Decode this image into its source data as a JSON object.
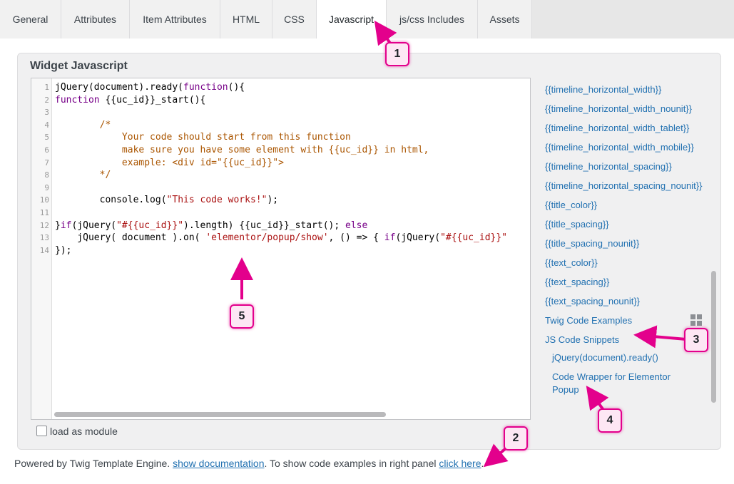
{
  "tabs": [
    {
      "label": "General"
    },
    {
      "label": "Attributes"
    },
    {
      "label": "Item Attributes"
    },
    {
      "label": "HTML"
    },
    {
      "label": "CSS"
    },
    {
      "label": "Javascript",
      "active": true
    },
    {
      "label": "js/css Includes"
    },
    {
      "label": "Assets"
    }
  ],
  "panel": {
    "title": "Widget Javascript"
  },
  "editor": {
    "line_numbers": [
      "1",
      "2",
      "3",
      "4",
      "5",
      "6",
      "7",
      "8",
      "9",
      "10",
      "11",
      "12",
      "13",
      "14"
    ],
    "lines": [
      [
        {
          "t": "jQuery(document).ready(",
          "c": ""
        },
        {
          "t": "function",
          "c": "kw"
        },
        {
          "t": "(){",
          "c": ""
        }
      ],
      [
        {
          "t": "function",
          "c": "kw"
        },
        {
          "t": " {{uc_id}}_start(){",
          "c": ""
        }
      ],
      [
        {
          "t": "",
          "c": ""
        }
      ],
      [
        {
          "t": "        /*",
          "c": "cmt"
        }
      ],
      [
        {
          "t": "            Your code should start from this function",
          "c": "cmt"
        }
      ],
      [
        {
          "t": "            make sure you have some element with {{uc_id}} in html,",
          "c": "cmt"
        }
      ],
      [
        {
          "t": "            example: <div id=\"{{uc_id}}\">",
          "c": "cmt"
        }
      ],
      [
        {
          "t": "        */",
          "c": "cmt"
        }
      ],
      [
        {
          "t": "",
          "c": ""
        }
      ],
      [
        {
          "t": "        console.log(",
          "c": ""
        },
        {
          "t": "\"This code works!\"",
          "c": "str"
        },
        {
          "t": ");",
          "c": ""
        }
      ],
      [
        {
          "t": "",
          "c": ""
        }
      ],
      [
        {
          "t": "}",
          "c": ""
        },
        {
          "t": "if",
          "c": "kw"
        },
        {
          "t": "(jQuery(",
          "c": ""
        },
        {
          "t": "\"#{{uc_id}}\"",
          "c": "str"
        },
        {
          "t": ").length) {{uc_id}}_start(); ",
          "c": ""
        },
        {
          "t": "else",
          "c": "kw"
        }
      ],
      [
        {
          "t": "    jQuery( document ).on( ",
          "c": ""
        },
        {
          "t": "'elementor/popup/show'",
          "c": "str"
        },
        {
          "t": ", () => { ",
          "c": ""
        },
        {
          "t": "if",
          "c": "kw"
        },
        {
          "t": "(jQuery(",
          "c": ""
        },
        {
          "t": "\"#{{uc_id}}\"",
          "c": "str"
        }
      ],
      [
        {
          "t": "});",
          "c": ""
        }
      ]
    ]
  },
  "side_panel": {
    "links": [
      "{{timeline_horizontal_width}}",
      "{{timeline_horizontal_width_nounit}}",
      "{{timeline_horizontal_width_tablet}}",
      "{{timeline_horizontal_width_mobile}}",
      "{{timeline_horizontal_spacing}}",
      "{{timeline_horizontal_spacing_nounit}}",
      "{{title_color}}",
      "{{title_spacing}}",
      "{{title_spacing_nounit}}",
      "{{text_color}}",
      "{{text_spacing}}",
      "{{text_spacing_nounit}}",
      "Twig Code Examples",
      "JS Code Snippets"
    ],
    "snippets": [
      "jQuery(document).ready()",
      "Code Wrapper for Elementor Popup"
    ],
    "icon": "grid-icon"
  },
  "checkbox": {
    "label": "load as module",
    "checked": false
  },
  "footer": {
    "prefix": "Powered by Twig Template Engine. ",
    "doc_link": "show documentation",
    "middle": ". To show code examples in right panel ",
    "click_link": "click here",
    "suffix": "."
  },
  "annotations": [
    "1",
    "2",
    "3",
    "4",
    "5"
  ],
  "colors": {
    "accent": "#e3008c",
    "link": "#2271b1"
  }
}
